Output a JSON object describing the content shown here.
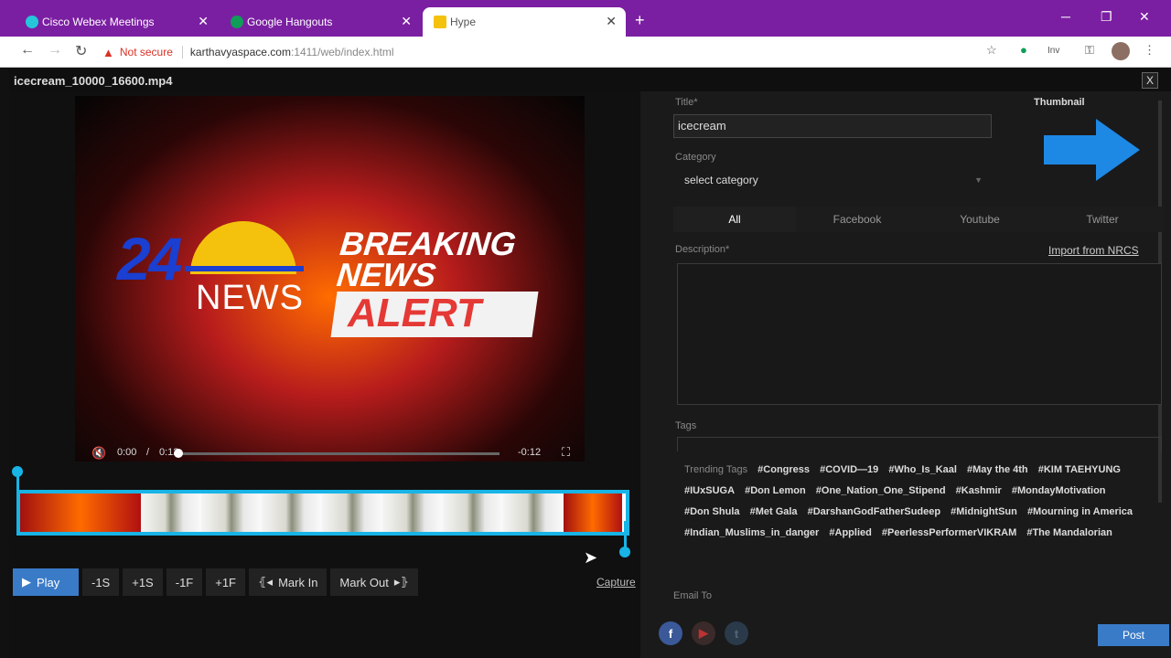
{
  "browser": {
    "tabs": [
      {
        "title": "Cisco Webex Meetings",
        "favicon_color": "#26c6da"
      },
      {
        "title": "Google Hangouts",
        "favicon_color": "#0f9d58"
      },
      {
        "title": "Hype",
        "favicon_color": "#f4c20d"
      }
    ],
    "active_tab": 2,
    "security_label": "Not secure",
    "url_host": "karthavyaspace.com",
    "url_path": ":1411/web/index.html",
    "profile_label": "Inv"
  },
  "editor": {
    "filename": "icecream_10000_16600.mp4",
    "close_label": "X",
    "player": {
      "time_current": "0:00",
      "time_separator": "/",
      "time_total": "0:12",
      "time_remaining": "-0:12"
    },
    "video_text": {
      "channel_number": "24",
      "channel_word": "NEWS",
      "breaking": "BREAKING",
      "news": "NEWS",
      "alert": "ALERT"
    },
    "buttons": {
      "play": "Play",
      "minus_1s": "-1S",
      "plus_1s": "+1S",
      "minus_1f": "-1F",
      "plus_1f": "+1F",
      "mark_in": "Mark In",
      "mark_out": "Mark Out",
      "capture": "Capture"
    }
  },
  "form": {
    "title_label": "Title*",
    "title_value": "icecream",
    "thumbnail_label": "Thumbnail",
    "category_label": "Category",
    "category_value": "select category",
    "platform_tabs": [
      "All",
      "Facebook",
      "Youtube",
      "Twitter"
    ],
    "active_platform": 0,
    "description_label": "Description*",
    "import_link": "Import from NRCS",
    "tags_label": "Tags",
    "trending_label": "Trending Tags",
    "trending_tags": [
      "#Congress",
      "#COVID—19",
      "#Who_Is_Kaal",
      "#May the 4th",
      "#KIM TAEHYUNG",
      "#IUxSUGA",
      "#Don Lemon",
      "#One_Nation_One_Stipend",
      "#Kashmir",
      "#MondayMotivation",
      "#Don Shula",
      "#Met Gala",
      "#DarshanGodFatherSudeep",
      "#MidnightSun",
      "#Mourning in America",
      "#Indian_Muslims_in_danger",
      "#Applied",
      "#PeerlessPerformerVIKRAM",
      "#The Mandalorian"
    ],
    "email_label": "Email To",
    "post_label": "Post",
    "accent_color": "#3a7bc8",
    "trim_color": "#18b4e6"
  }
}
